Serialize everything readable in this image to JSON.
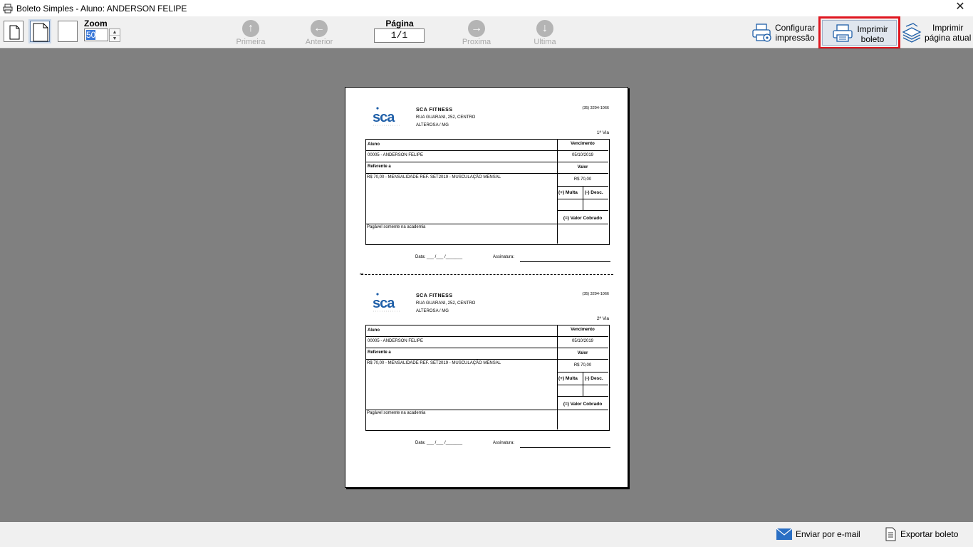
{
  "window": {
    "title": "Boleto Simples - Aluno: ANDERSON FELIPE"
  },
  "toolbar": {
    "zoom_label": "Zoom",
    "zoom_value": "50",
    "page_label": "Página",
    "page_value": "1/1",
    "nav": {
      "first": "Primeira",
      "previous": "Anterior",
      "next": "Proxima",
      "last": "Ultima"
    },
    "configure_line1": "Configurar",
    "configure_line2": "impressão",
    "print_boleto_line1": "Imprimir",
    "print_boleto_line2": "boleto",
    "print_page_line1": "Imprimir",
    "print_page_line2": "página atual"
  },
  "bottom": {
    "email": "Enviar por e-mail",
    "export": "Exportar boleto"
  },
  "boleto": {
    "company_name": "SCA FITNESS",
    "address1": "RUA GUARANI, 252, CENTRO",
    "address2": "ALTEROSA / MG",
    "phone": "(35) 3294-1066",
    "logo_text": "sca",
    "via1": "1ª Via",
    "via2": "2ª Via",
    "aluno_label": "Aluno",
    "aluno_value": "00005 - ANDERSON FELIPE",
    "vencimento_label": "Vencimento",
    "vencimento_value": "05/10/2019",
    "referente_label": "Referente a",
    "referente_value": "R$ 70,00 - MENSALIDADE REF. SET2019 - MUSCULAÇÃO MENSAL",
    "valor_label": "Valor",
    "valor_value": "R$ 70,00",
    "multa_label": "(+) Multa",
    "desc_label": "(-) Desc.",
    "valor_cobrado_label": "(=) Valor Cobrado",
    "pagavel": "Pagável somente na academia",
    "data_label": "Data:  ___ /___ /_______",
    "assinatura_label": "Assinatura:"
  }
}
